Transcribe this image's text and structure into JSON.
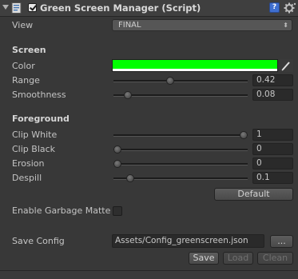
{
  "header": {
    "title": "Green Screen Manager (Script)",
    "script_icon": "script-file-icon",
    "enabled": true,
    "help_icon_glyph": "?",
    "help_icon": "help-book-icon",
    "settings_icon": "gear-icon"
  },
  "view": {
    "label": "View",
    "value": "FINAL",
    "arrow": "⬍"
  },
  "screen": {
    "heading": "Screen",
    "color": {
      "label": "Color",
      "value": "#00ff00"
    },
    "range": {
      "label": "Range",
      "value": "0.42",
      "fraction": 0.42
    },
    "smoothness": {
      "label": "Smoothness",
      "value": "0.08",
      "fraction": 0.08
    }
  },
  "foreground": {
    "heading": "Foreground",
    "clip_white": {
      "label": "Clip White",
      "value": "1",
      "fraction": 1.0
    },
    "clip_black": {
      "label": "Clip Black",
      "value": "0",
      "fraction": 0.0
    },
    "erosion": {
      "label": "Erosion",
      "value": "0",
      "fraction": 0.0
    },
    "despill": {
      "label": "Despill",
      "value": "0.1",
      "fraction": 0.1
    },
    "default_button": "Default"
  },
  "garbage_matte": {
    "label": "Enable Garbage Matte",
    "checked": false
  },
  "config": {
    "label": "Save Config",
    "path": "Assets/Config_greenscreen.json",
    "browse_label": "...",
    "save_label": "Save",
    "load_label": "Load",
    "clean_label": "Clean"
  },
  "colors": {
    "panel_bg": "#383838",
    "accent_green": "#00ff00",
    "text": "#c4c4c4"
  }
}
